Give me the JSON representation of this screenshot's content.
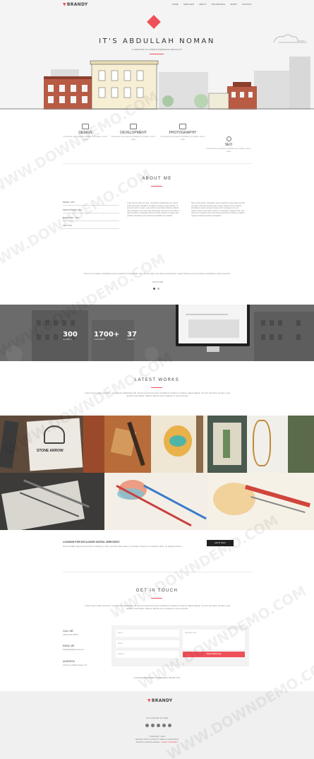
{
  "brand": {
    "name": "BRANDY",
    "accent": "#f0505a"
  },
  "nav": {
    "items": [
      "HOME",
      "SERVICES",
      "ABOUT",
      "TESTIMONIAL",
      "WORK",
      "CONTACT"
    ]
  },
  "hero": {
    "title": "IT'S ABDULLAH NOMAN",
    "subtitle": "A CREATIVE UI & USER EXPERIENCE SPECIALIST"
  },
  "services": [
    {
      "name": "DESIGN",
      "text": "Consectetur sint occaecat cupidatat non proident, sunt in culpa."
    },
    {
      "name": "DEVELOPMENT",
      "text": "Consectetur sint occaecat cupidatat non proident, sunt in culpa."
    },
    {
      "name": "PHOTOGRAPHY",
      "text": "Consectetur sint occaecat cupidatat non proident, sunt in culpa."
    },
    {
      "name": "SEO",
      "text": "Consectetur sint occaecat cupidatat non proident, sunt in culpa."
    }
  ],
  "about": {
    "title": "ABOUT ME",
    "skills": [
      "BRAND - 80%",
      "DEVELOPMENT - 60%",
      "MARKETING - 70%",
      "SEO - 50%"
    ],
    "para1": "Lorem ipsum dolor sit amet, consectetur adipisicing elit, sed do eiusmod tempor incididunt ut labore et dolore magna aliqua. Ut enim ad minim veniam, quis nostrud exercitation ullamco laboris nisi ut aliquip ex ea commodo consequat. Duis aute irure dolor in reprehenderit in voluptate velit esse cillum dolore eu fugiat nulla pariatur. Excepteur sint occaecat cupidatat non proident.",
    "para2": "Nemo enim ipsam voluptatem quia voluptas sit aspernatur aut odit aut fugit, sed quia consequuntur magni dolores eos qui ratione voluptatem sequi nesciunt. Neque porro quisquam est, qui dolorem ipsum quia dolor sit amet, consectetur, adipisci velit, sed quia non numquam eius modi tempora incidunt ut labore et dolore magnam aliquam quaerat voluptatem.",
    "quote": "Nemo enim ipsam voluptatem quia voluptas sit aspernatur aut odit aut fugit, sed quia consequuntur magni dolores eos qui ratione voluptatem sequi nesciunt.",
    "quote_author": "- JOHN DOE"
  },
  "stats": [
    {
      "number": "300",
      "label": "PROJECTS"
    },
    {
      "number": "1700+",
      "label": "CUSTOMERS"
    },
    {
      "number": "37",
      "label": "AWARDS"
    }
  ],
  "works": {
    "title": "LATEST WORKS",
    "intro": "Lorem ipsum dolor sit amet, consectetur adipisicing elit, sed do eiusmod tempor incididunt ut labore et dolore magna aliqua. Ut enim ad minim veniam, quis nostrud exercitation ullamco laboris nisi ut aliquip ex ea commodo.",
    "badge_text": "STONE ARROW"
  },
  "cta": {
    "title": "LOOKING FOR EXCLUSIVE DIGITAL SERVICES?",
    "text": "Proin fringilla augue at maximus vestibulum. Nam pulvinar vitae neque et porttitor. Integer non dapibus diam, ac eleifend lectus.",
    "button": "LET'S TALK"
  },
  "contact": {
    "title": "GET IN TOUCH",
    "intro": "Lorem ipsum dolor sit amet, consectetur adipisicing elit, sed do eiusmod tempor incididunt ut labore et dolore magna aliqua. Ut enim ad minim veniam, quis nostrud exercitation ullamco laboris nisi ut aliquip ex ea commodo.",
    "call_label": "CALL ME",
    "call_value": "+88 (0) 101 0000 0",
    "email_label": "EMAIL ME",
    "email_value": "info@abdullahnoman.com",
    "address_label": "ADDRESS",
    "address_value": "123 Some Address Street, NY",
    "name_placeholder": "Name",
    "email_placeholder": "Email",
    "subject_placeholder": "Subject",
    "message_placeholder": "Message Here",
    "send_label": "SEND MESSAGE",
    "note": "LOOKING FORWARD TO HEARING FROM YOU"
  },
  "footer": {
    "follow": "FOLLOW ME ON WEB",
    "copy1": "© BRANDY 2016",
    "copy2": "DESIGN WITH LOVE BY ABDULLAHNOMAN",
    "copy3": "MADE IN BANGLADESH",
    "copy4": "MAIN CONTENT"
  },
  "watermark": "WWW.DOWNDEMO.COM"
}
